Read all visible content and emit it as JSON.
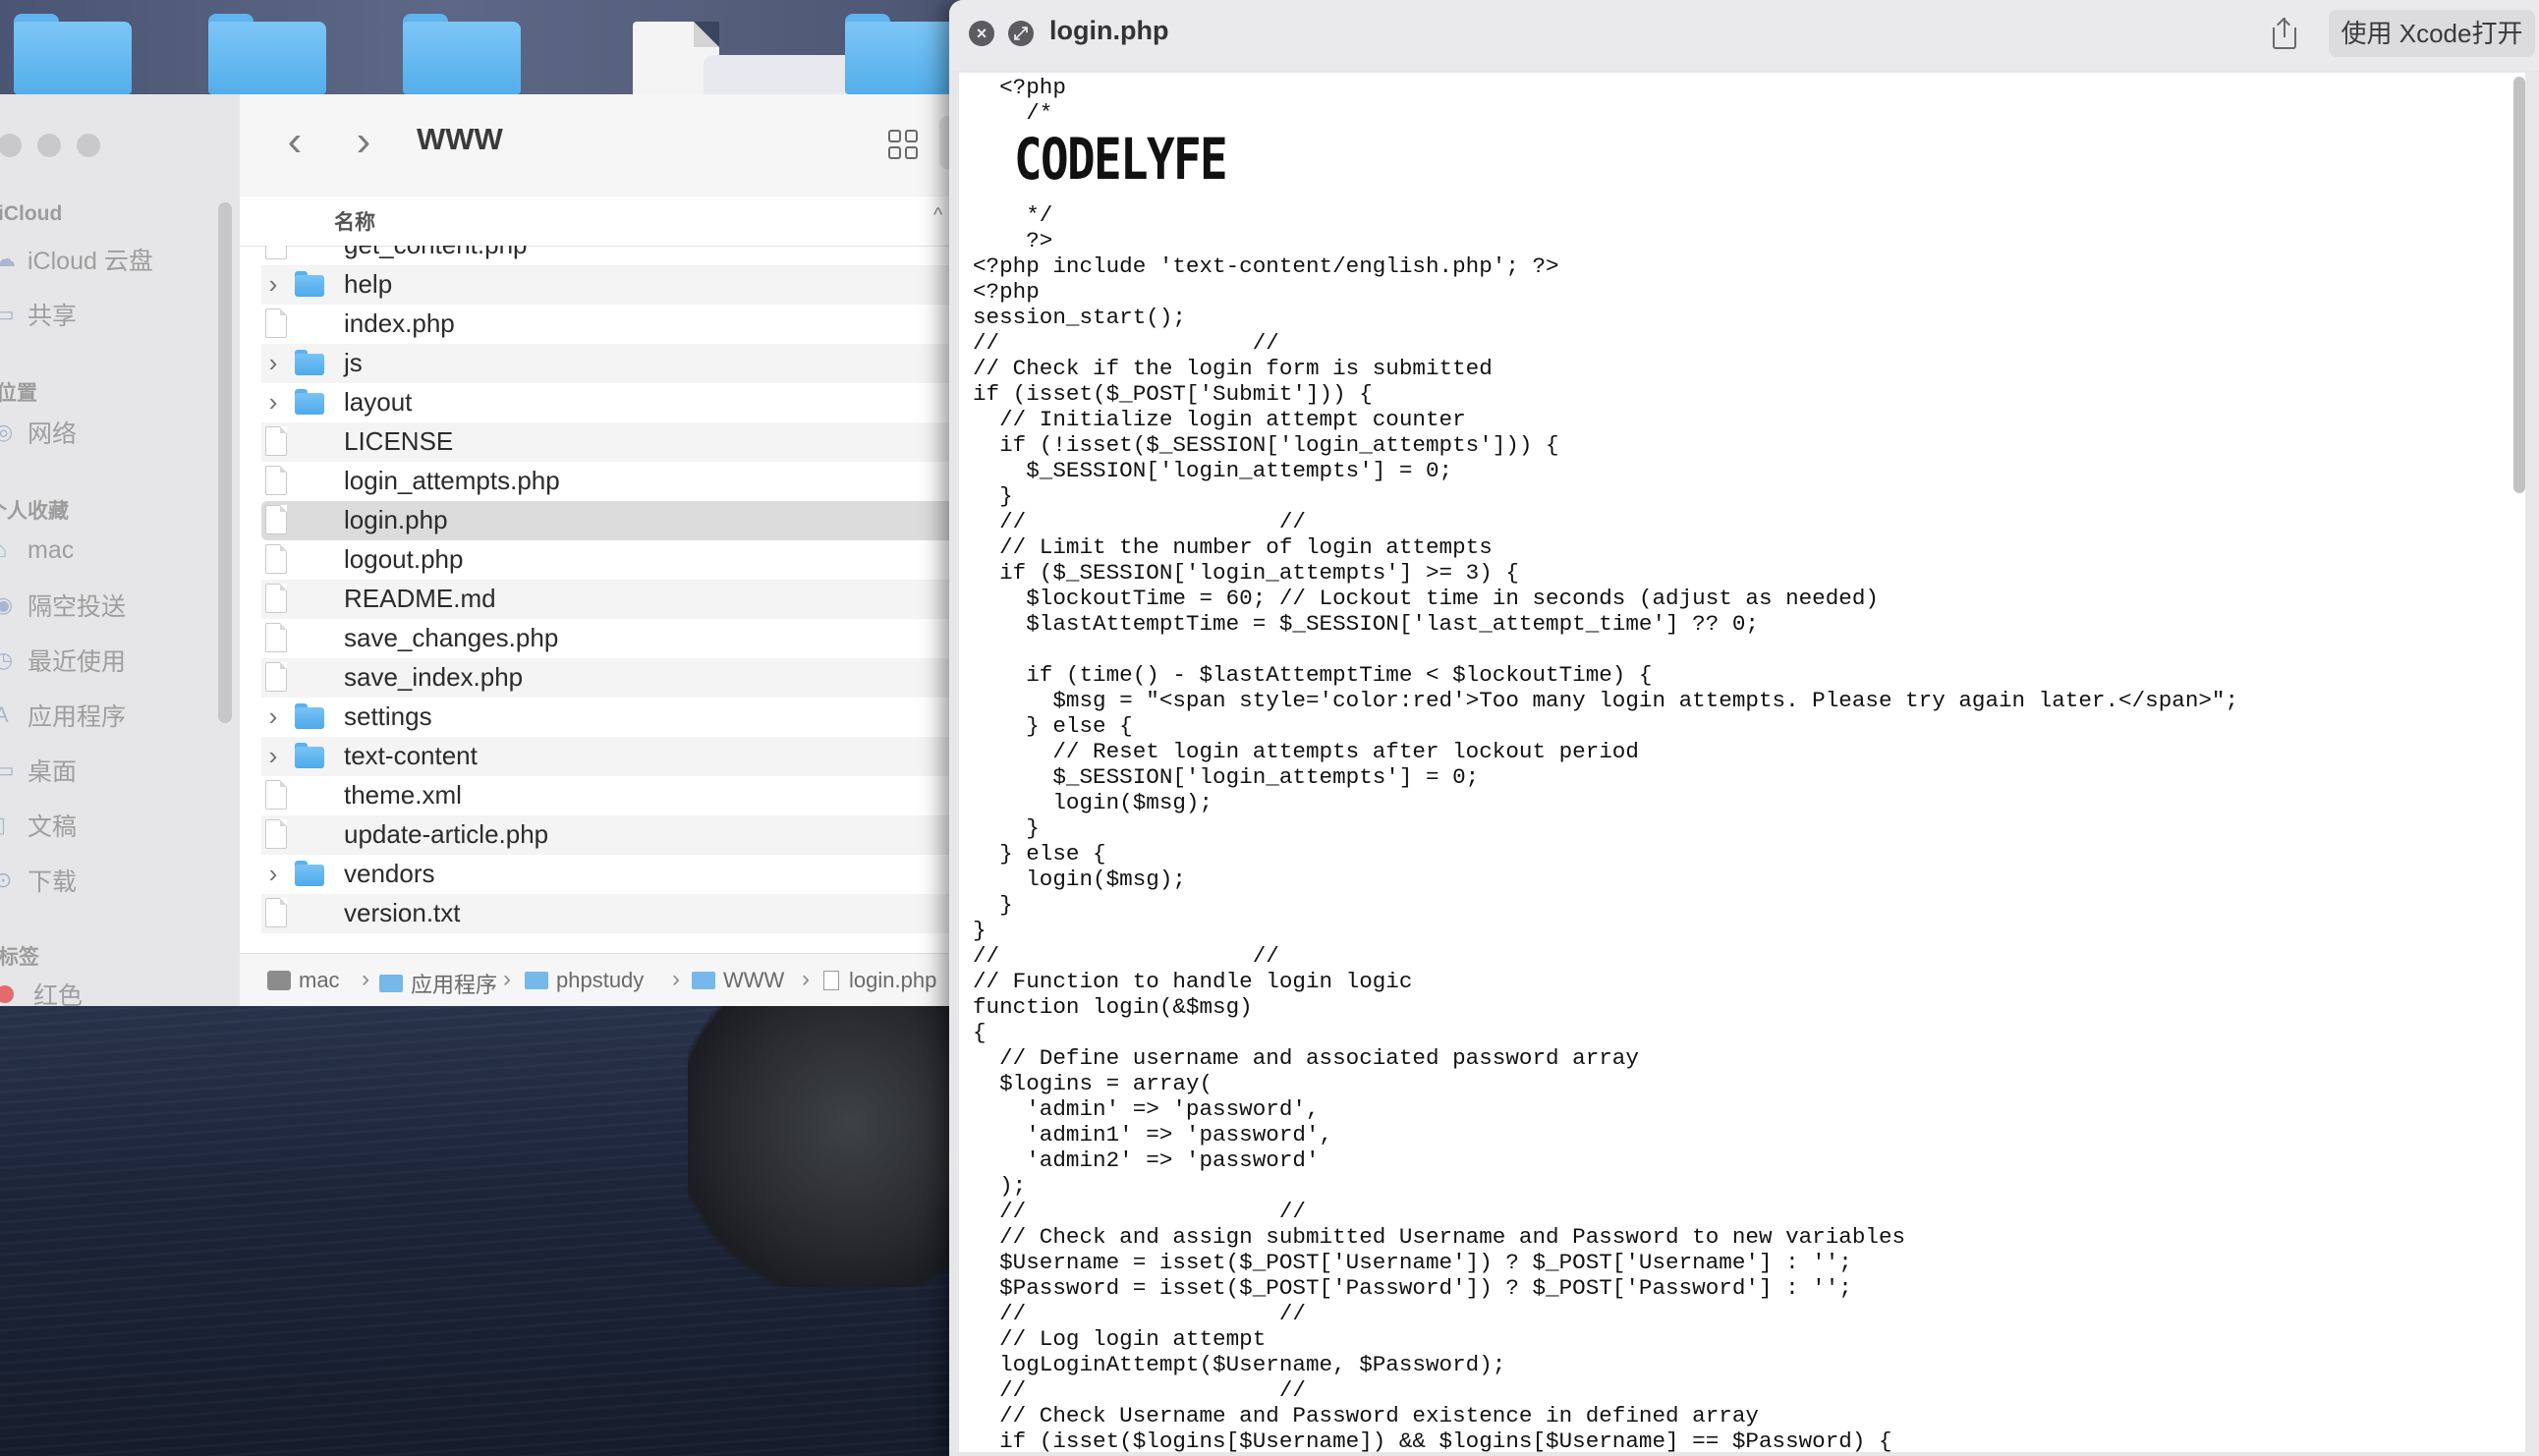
{
  "finder": {
    "folder_title": "WWW",
    "sidebar": {
      "sections": [
        {
          "heading": "iCloud",
          "items": [
            {
              "label": "iCloud 云盘",
              "icon": "cloud-icon"
            },
            {
              "label": "共享",
              "icon": "shared-folder-icon"
            }
          ]
        },
        {
          "heading": "位置",
          "items": [
            {
              "label": "网络",
              "icon": "network-icon"
            }
          ]
        },
        {
          "heading": "个人收藏",
          "items": [
            {
              "label": "mac",
              "icon": "home-icon"
            },
            {
              "label": "隔空投送",
              "icon": "airdrop-icon"
            },
            {
              "label": "最近使用",
              "icon": "clock-icon"
            },
            {
              "label": "应用程序",
              "icon": "applications-icon"
            },
            {
              "label": "桌面",
              "icon": "desktop-icon"
            },
            {
              "label": "文稿",
              "icon": "document-icon"
            },
            {
              "label": "下载",
              "icon": "download-icon"
            }
          ]
        },
        {
          "heading": "标签",
          "items": [
            {
              "label": "红色",
              "icon": "red-tag-icon"
            }
          ]
        }
      ]
    },
    "column_header": "名称",
    "files": [
      {
        "name": "get_content.php",
        "kind": "php",
        "partial": true
      },
      {
        "name": "help",
        "kind": "folder"
      },
      {
        "name": "index.php",
        "kind": "php"
      },
      {
        "name": "js",
        "kind": "folder"
      },
      {
        "name": "layout",
        "kind": "folder"
      },
      {
        "name": "LICENSE",
        "kind": "blank"
      },
      {
        "name": "login_attempts.php",
        "kind": "php"
      },
      {
        "name": "login.php",
        "kind": "php",
        "selected": true
      },
      {
        "name": "logout.php",
        "kind": "php"
      },
      {
        "name": "README.md",
        "kind": "md"
      },
      {
        "name": "save_changes.php",
        "kind": "php"
      },
      {
        "name": "save_index.php",
        "kind": "php"
      },
      {
        "name": "settings",
        "kind": "folder"
      },
      {
        "name": "text-content",
        "kind": "folder"
      },
      {
        "name": "theme.xml",
        "kind": "xml"
      },
      {
        "name": "update-article.php",
        "kind": "php"
      },
      {
        "name": "vendors",
        "kind": "folder"
      },
      {
        "name": "version.txt",
        "kind": "txt"
      }
    ],
    "path": [
      "mac",
      "应用程序",
      "phpstudy",
      "WWW",
      "login.php"
    ]
  },
  "quicklook": {
    "title": "login.php",
    "open_button": "使用 Xcode打开",
    "ascii_art": "CODELYFE",
    "code_lines": [
      "  <?php",
      "    /*",
      "",
      "",
      "",
      "    */",
      "    ?>",
      "<?php include 'text-content/english.php'; ?>",
      "<?php",
      "session_start();",
      "//                   //",
      "// Check if the login form is submitted",
      "if (isset($_POST['Submit'])) {",
      "  // Initialize login attempt counter",
      "  if (!isset($_SESSION['login_attempts'])) {",
      "    $_SESSION['login_attempts'] = 0;",
      "  }",
      "  //                   //",
      "  // Limit the number of login attempts",
      "  if ($_SESSION['login_attempts'] >= 3) {",
      "    $lockoutTime = 60; // Lockout time in seconds (adjust as needed)",
      "    $lastAttemptTime = $_SESSION['last_attempt_time'] ?? 0;",
      "",
      "    if (time() - $lastAttemptTime < $lockoutTime) {",
      "      $msg = \"<span style='color:red'>Too many login attempts. Please try again later.</span>\";",
      "    } else {",
      "      // Reset login attempts after lockout period",
      "      $_SESSION['login_attempts'] = 0;",
      "      login($msg);",
      "    }",
      "  } else {",
      "    login($msg);",
      "  }",
      "}",
      "//                   //",
      "// Function to handle login logic",
      "function login(&$msg)",
      "{",
      "  // Define username and associated password array",
      "  $logins = array(",
      "    'admin' => 'password',",
      "    'admin1' => 'password',",
      "    'admin2' => 'password'",
      "  );",
      "  //                   //",
      "  // Check and assign submitted Username and Password to new variables",
      "  $Username = isset($_POST['Username']) ? $_POST['Username'] : '';",
      "  $Password = isset($_POST['Password']) ? $_POST['Password'] : '';",
      "  //                   //",
      "  // Log login attempt",
      "  logLoginAttempt($Username, $Password);",
      "  //                   //",
      "  // Check Username and Password existence in defined array",
      "  if (isset($logins[$Username]) && $logins[$Username] == $Password) {"
    ]
  },
  "colors": {
    "folder_blue": "#5bb1ef",
    "selection": "#dcdcdc",
    "tag_red": "#e36b6b"
  }
}
